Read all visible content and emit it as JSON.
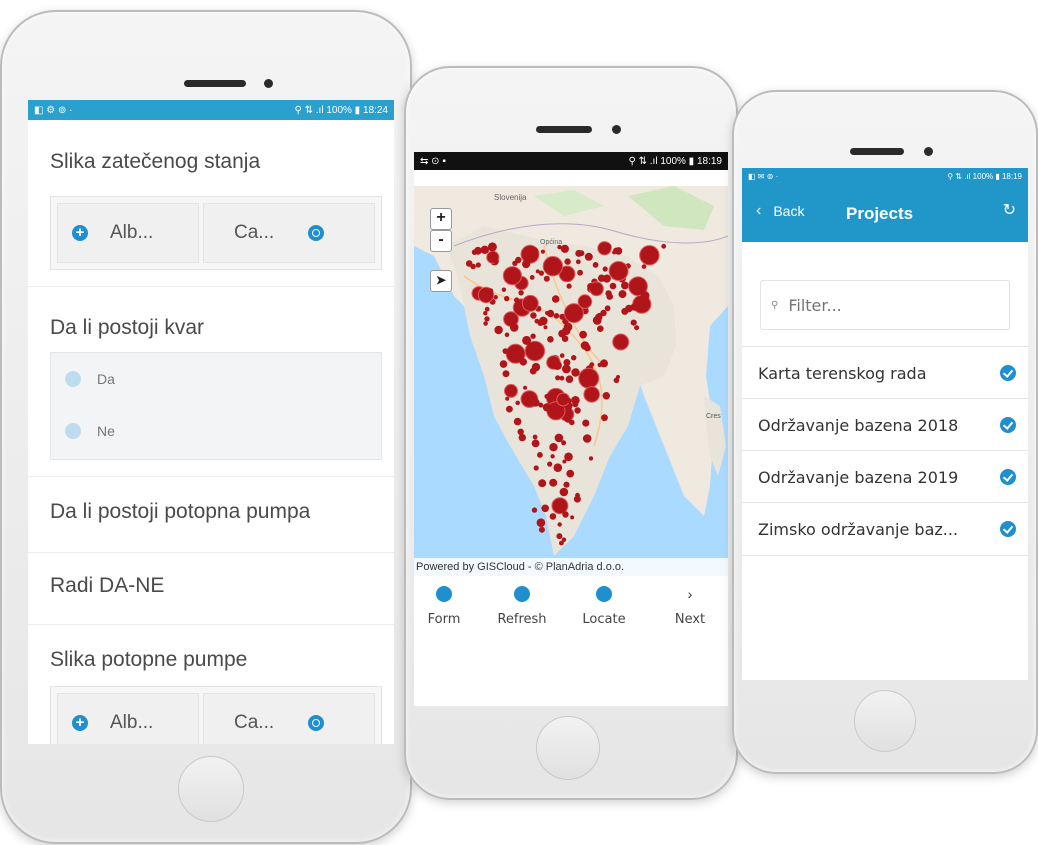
{
  "colors": {
    "accent": "#1f8fd0",
    "status_bar_blue": "#2196c9",
    "status_bar_black": "#111111",
    "marker_red": "#b0151a"
  },
  "phone_form": {
    "status_bar": {
      "left_icons": "◧ ⚙ ⊚ ·",
      "right_text": "⚲ ⇅ .ıl 100% ▮ 18:24"
    },
    "fields": [
      {
        "label": "Slika zatečenog stanja",
        "type": "attachment",
        "album_label": "Alb...",
        "camera_label": "Ca..."
      },
      {
        "label": "Da li postoji kvar",
        "type": "radio",
        "options": [
          "Da",
          "Ne"
        ]
      },
      {
        "label": "Da li postoji potopna pumpa",
        "type": "text"
      },
      {
        "label": "Radi DA-NE",
        "type": "text"
      },
      {
        "label": "Slika potopne pumpe",
        "type": "attachment",
        "album_label": "Alb...",
        "camera_label": "Ca..."
      }
    ]
  },
  "phone_map": {
    "status_bar": {
      "left_icons": "⇆ ⊙ ▪",
      "right_text": "⚲ ⇅ .ıl 100% ▮ 18:19"
    },
    "zoom_in": "+",
    "zoom_out": "-",
    "map_labels": [
      "Slovenija",
      "Općina",
      "Cres"
    ],
    "attribution": "Powered by GISCloud - © PlanAdria d.o.o.",
    "toolbar": [
      {
        "label": "Form",
        "icon": "form-icon"
      },
      {
        "label": "Refresh",
        "icon": "refresh-icon"
      },
      {
        "label": "Locate",
        "icon": "locate-icon"
      },
      {
        "label": "Next",
        "icon": "chevron-right-icon"
      }
    ]
  },
  "phone_projects": {
    "status_bar": {
      "left_icons": "◧ ✉ ⊚ ·",
      "right_text": "⚲ ⇅ .ıl 100% ▮ 18:19"
    },
    "back_label": "Back",
    "title": "Projects",
    "filter_placeholder": "Filter...",
    "projects": [
      "Karta terenskog rada",
      "Održavanje bazena 2018",
      "Održavanje bazena 2019",
      "Zimsko održavanje baz..."
    ]
  }
}
